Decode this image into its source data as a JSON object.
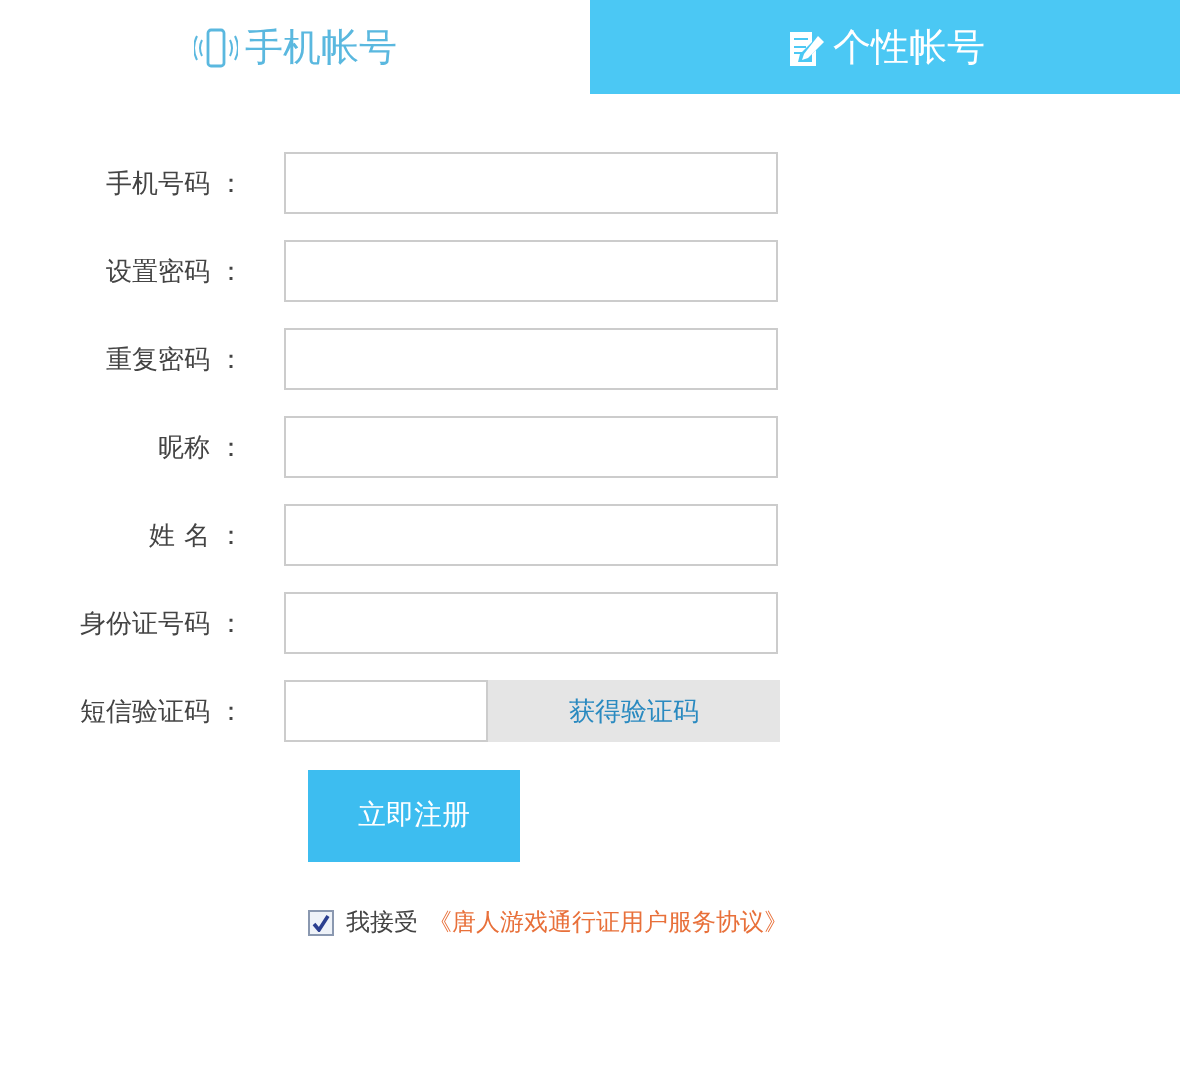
{
  "tabs": [
    {
      "label": "手机帐号",
      "kind": "phone",
      "selected": true
    },
    {
      "label": "个性帐号",
      "kind": "edit",
      "selected": false
    }
  ],
  "fields": [
    {
      "label": "手机号码 ："
    },
    {
      "label": "设置密码 ："
    },
    {
      "label": "重复密码 ："
    },
    {
      "label": "昵称 ："
    },
    {
      "label": "姓 名 ："
    },
    {
      "label": "身份证号码 ："
    }
  ],
  "sms": {
    "label": "短信验证码 ：",
    "button": "获得验证码"
  },
  "submit": "立即注册",
  "agreement": {
    "checked": true,
    "text": "我接受",
    "link": "《唐人游戏通行证用户服务协议》"
  }
}
